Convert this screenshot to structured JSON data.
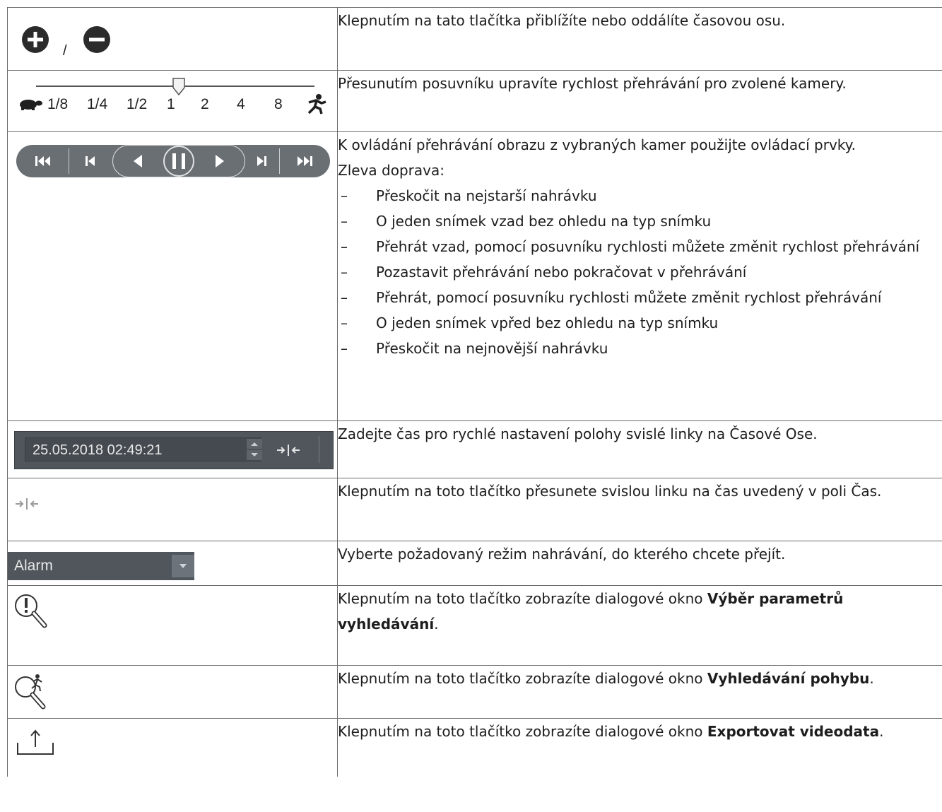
{
  "rows": [
    {
      "description": "Klepnutím na tato tlačítka přiblížíte nebo oddálíte časovou osu.",
      "separator": "/"
    },
    {
      "description": "Přesunutím posuvníku upravíte rychlost přehrávání pro zvolené kamery.",
      "speeds": [
        "1/8",
        "1/4",
        "1/2",
        "1",
        "2",
        "4",
        "8"
      ]
    },
    {
      "intro": "K ovládání přehrávání obrazu z vybraných kamer použijte ovládací prvky.",
      "intro2": "Zleva doprava:",
      "dash": "–",
      "items": [
        "Přeskočit na nejstarší nahrávku",
        "O jeden snímek vzad bez ohledu na typ snímku",
        "Přehrát vzad, pomocí posuvníku rychlosti můžete změnit rychlost přehrávání",
        "Pozastavit přehrávání nebo pokračovat v přehrávání",
        "Přehrát, pomocí posuvníku rychlosti můžete změnit rychlost přehrávání",
        "O jeden snímek vpřed bez ohledu na typ snímku",
        "Přeskočit na nejnovější nahrávku"
      ]
    },
    {
      "description": "Zadejte čas pro rychlé nastavení polohy svislé linky na Časové Ose.",
      "datetime_value": "25.05.2018 02:49:21"
    },
    {
      "description": "Klepnutím na toto tlačítko přesunete svislou linku na čas uvedený v poli Čas."
    },
    {
      "description": "Vyberte požadovaný režim nahrávání, do kterého chcete přejít.",
      "select_value": "Alarm"
    },
    {
      "desc_prefix": "Klepnutím na toto tlačítko zobrazíte dialogové okno ",
      "desc_bold": "Výběr parametrů vyhledávání",
      "desc_suffix": "."
    },
    {
      "desc_prefix": "Klepnutím na toto tlačítko zobrazíte dialogové okno ",
      "desc_bold": "Vyhledávání pohybu",
      "desc_suffix": "."
    },
    {
      "desc_prefix": "Klepnutím na toto tlačítko zobrazíte dialogové okno ",
      "desc_bold": "Exportovat videodata",
      "desc_suffix": "."
    }
  ],
  "icons": {
    "zoom_in": "plus-circle-icon",
    "zoom_out": "minus-circle-icon",
    "slow": "turtle-icon",
    "fast": "running-man-icon",
    "goto_time": "jump-to-time-icon",
    "alarm_search": "alarm-search-icon",
    "motion_search": "motion-search-icon",
    "export": "export-icon"
  },
  "colors": {
    "control_bg": "#6a6f74",
    "field_bg": "#50565c",
    "icon_dark": "#2b2b2b"
  }
}
